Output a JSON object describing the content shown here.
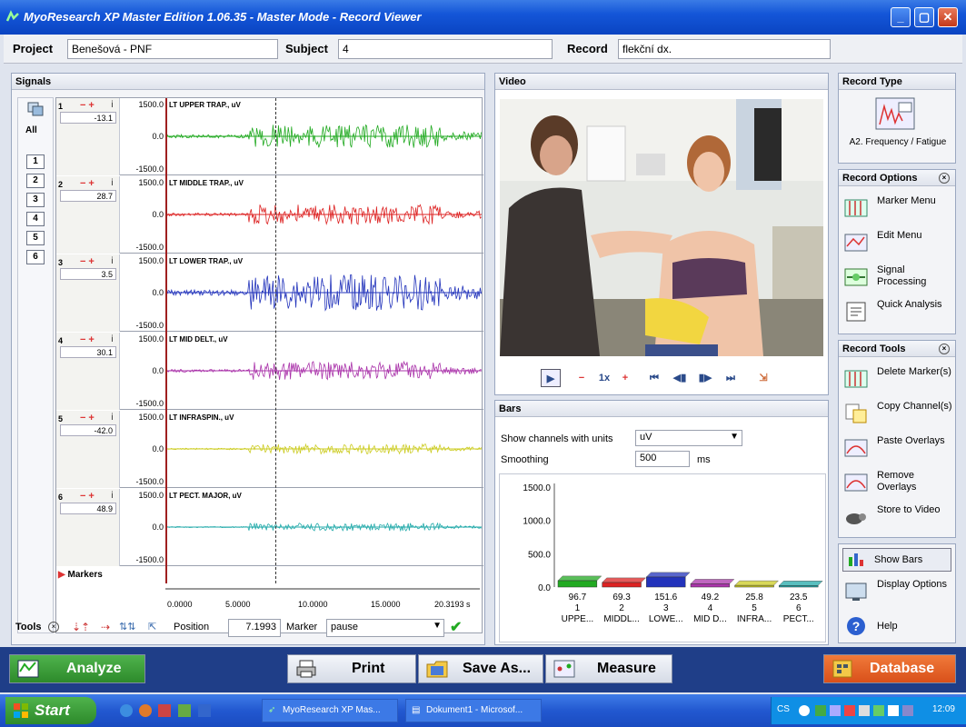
{
  "window": {
    "title": "MyoResearch XP Master Edition 1.06.35 - Master Mode - Record Viewer"
  },
  "project_bar": {
    "project_label": "Project",
    "project_value": "Benešová - PNF",
    "subject_label": "Subject",
    "subject_value": "4",
    "record_label": "Record",
    "record_value": "flekční dx."
  },
  "signals": {
    "title": "Signals",
    "all_label": "All",
    "channel_buttons": [
      "1",
      "2",
      "3",
      "4",
      "5",
      "6"
    ],
    "channels": [
      {
        "num": "1",
        "value": "-13.1",
        "top": "1500.0",
        "mid": "0.0",
        "bottom": "-1500.0",
        "name": "LT UPPER TRAP., uV",
        "color": "#22aa22",
        "amplitude": 0.35
      },
      {
        "num": "2",
        "value": "28.7",
        "top": "1500.0",
        "mid": "0.0",
        "bottom": "-1500.0",
        "name": "LT MIDDLE TRAP., uV",
        "color": "#dd2222",
        "amplitude": 0.3
      },
      {
        "num": "3",
        "value": "3.5",
        "top": "1500.0",
        "mid": "0.0",
        "bottom": "-1500.0",
        "name": "LT LOWER TRAP., uV",
        "color": "#2233bb",
        "amplitude": 0.55
      },
      {
        "num": "4",
        "value": "30.1",
        "top": "1500.0",
        "mid": "0.0",
        "bottom": "-1500.0",
        "name": "LT MID DELT., uV",
        "color": "#aa33aa",
        "amplitude": 0.28
      },
      {
        "num": "5",
        "value": "-42.0",
        "top": "1500.0",
        "mid": "0.0",
        "bottom": "-1500.0",
        "name": "LT INFRASPIN., uV",
        "color": "#cccc22",
        "amplitude": 0.15
      },
      {
        "num": "6",
        "value": "48.9",
        "top": "1500.0",
        "mid": "0.0",
        "bottom": "-1500.0",
        "name": "LT PECT. MAJOR, uV",
        "color": "#22aaaa",
        "amplitude": 0.12
      }
    ],
    "markers_label": "Markers",
    "x_ticks": [
      "0.0000",
      "5.0000",
      "10.0000",
      "15.0000",
      "20.3193 s"
    ]
  },
  "tools": {
    "label": "Tools",
    "position_label": "Position",
    "position_value": "7.1993",
    "marker_label": "Marker",
    "marker_value": "pause"
  },
  "video": {
    "title": "Video",
    "speed": "1x"
  },
  "bars": {
    "title": "Bars",
    "units_label": "Show channels with units",
    "units_value": "uV",
    "smoothing_label": "Smoothing",
    "smoothing_value": "500",
    "smoothing_unit": "ms",
    "chart_data": {
      "type": "bar",
      "categories": [
        "1",
        "2",
        "3",
        "4",
        "5",
        "6"
      ],
      "category_labels": [
        "UPPE...",
        "MIDDL...",
        "LOWE...",
        "MID D...",
        "INFRA...",
        "PECT..."
      ],
      "values": [
        96.7,
        69.3,
        151.6,
        49.2,
        25.8,
        23.5
      ],
      "value_labels": [
        "96.7",
        "69.3",
        "151.6",
        "49.2",
        "25.8",
        "23.5"
      ],
      "colors": [
        "#22aa22",
        "#dd2222",
        "#2233bb",
        "#aa33aa",
        "#cccc22",
        "#22aaaa"
      ],
      "y_ticks": [
        "1500.0",
        "1000.0",
        "500.0",
        "0.0"
      ],
      "ylim": [
        0,
        1500
      ]
    }
  },
  "record_type": {
    "title": "Record Type",
    "label": "A2. Frequency / Fatigue"
  },
  "record_options": {
    "title": "Record Options",
    "items": [
      "Marker Menu",
      "Edit Menu",
      "Signal Processing",
      "Quick Analysis"
    ]
  },
  "record_tools": {
    "title": "Record Tools",
    "items": [
      "Delete Marker(s)",
      "Copy Channel(s)",
      "Paste Overlays",
      "Remove Overlays",
      "Store to Video"
    ]
  },
  "view_options": {
    "items": [
      "Show Bars",
      "Display Options",
      "Help"
    ]
  },
  "actions": {
    "analyze": "Analyze",
    "print": "Print",
    "save_as": "Save As...",
    "measure": "Measure",
    "database": "Database"
  },
  "taskbar": {
    "start": "Start",
    "task1": "MyoResearch XP Mas...",
    "task2": "Dokument1 - Microsof...",
    "lang": "CS",
    "clock": "12:09"
  }
}
